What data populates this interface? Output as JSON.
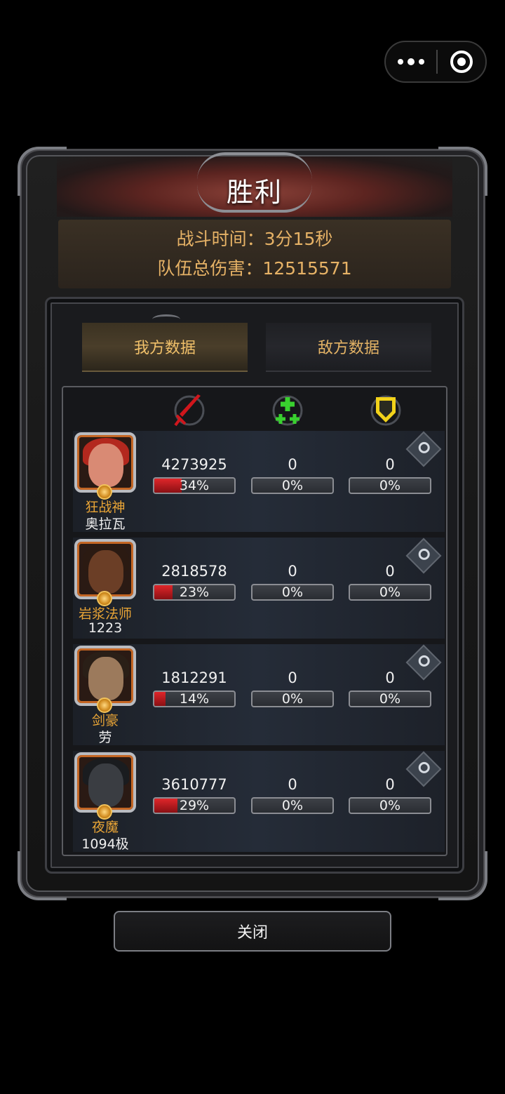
{
  "capsule": {
    "more_icon": "more-dots-icon",
    "close_icon": "target-circle-icon"
  },
  "dialog": {
    "title": "胜利",
    "battle_time": "战斗时间：3分15秒",
    "total_damage": "队伍总伤害：12515571"
  },
  "tabs": [
    {
      "label": "我方数据",
      "active": true
    },
    {
      "label": "敌方数据",
      "active": false
    }
  ],
  "columns": [
    {
      "icon": "sword-icon",
      "color": "#d0161c"
    },
    {
      "icon": "heal-plus-icon",
      "color": "#39d12f"
    },
    {
      "icon": "shield-icon",
      "color": "#f2d21a"
    }
  ],
  "heroes": [
    {
      "class": "狂战神",
      "name": "奥拉瓦",
      "damage": "4273925",
      "damage_pct": "34%",
      "damage_ratio": 0.34,
      "heal": "0",
      "heal_pct": "0%",
      "heal_ratio": 0,
      "tank": "0",
      "tank_pct": "0%",
      "tank_ratio": 0,
      "portrait": {
        "face": "#d98a74",
        "hair": "#b3281e"
      }
    },
    {
      "class": "岩浆法师",
      "name": "1223",
      "damage": "2818578",
      "damage_pct": "23%",
      "damage_ratio": 0.23,
      "heal": "0",
      "heal_pct": "0%",
      "heal_ratio": 0,
      "tank": "0",
      "tank_pct": "0%",
      "tank_ratio": 0,
      "portrait": {
        "face": "#6b3e26",
        "hair": "#2b1a12"
      }
    },
    {
      "class": "剑豪",
      "name": "劳",
      "damage": "1812291",
      "damage_pct": "14%",
      "damage_ratio": 0.14,
      "heal": "0",
      "heal_pct": "0%",
      "heal_ratio": 0,
      "tank": "0",
      "tank_pct": "0%",
      "tank_ratio": 0,
      "portrait": {
        "face": "#9c7a5c",
        "hair": "#2a1f17"
      }
    },
    {
      "class": "夜魔",
      "name": "1094极",
      "damage": "3610777",
      "damage_pct": "29%",
      "damage_ratio": 0.29,
      "heal": "0",
      "heal_pct": "0%",
      "heal_ratio": 0,
      "tank": "0",
      "tank_pct": "0%",
      "tank_ratio": 0,
      "portrait": {
        "face": "#3a3d42",
        "hair": "#1a1c1f"
      }
    }
  ],
  "close_label": "关闭"
}
